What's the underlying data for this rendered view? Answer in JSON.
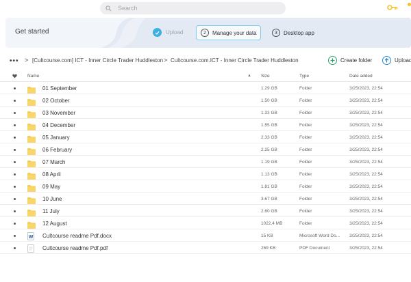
{
  "search": {
    "placeholder": "Search"
  },
  "banner": {
    "title": "Get started",
    "steps": [
      {
        "number": "",
        "label": "Upload",
        "state": "done"
      },
      {
        "number": "2",
        "label": "Manage your data",
        "state": "active"
      },
      {
        "number": "3",
        "label": "Desktop app",
        "state": "todo"
      }
    ]
  },
  "breadcrumb": {
    "more": "•••",
    "items": [
      "[Cultcourse.com] ICT - Inner Circle Trader Huddleston",
      "Cultcourse.com.ICT - Inner Circle Trader Huddleston"
    ],
    "separator": ">"
  },
  "actions": {
    "create_folder": "Create folder",
    "upload": "Upload"
  },
  "table": {
    "headers": {
      "name": "Name",
      "size": "Size",
      "type": "Type",
      "date": "Date added",
      "sort_arrow": "▲"
    },
    "rows": [
      {
        "name": "01 September",
        "size": "1.29 GB",
        "type": "Folder",
        "date": "3/25/2023, 22:54",
        "icon": "folder-icon"
      },
      {
        "name": "02 October",
        "size": "1.50 GB",
        "type": "Folder",
        "date": "3/25/2023, 22:54",
        "icon": "folder-icon"
      },
      {
        "name": "03 November",
        "size": "1.33 GB",
        "type": "Folder",
        "date": "3/25/2023, 22:54",
        "icon": "folder-icon"
      },
      {
        "name": "04 December",
        "size": "1.55 GB",
        "type": "Folder",
        "date": "3/25/2023, 22:54",
        "icon": "folder-icon"
      },
      {
        "name": "05 January",
        "size": "2.33 GB",
        "type": "Folder",
        "date": "3/25/2023, 22:54",
        "icon": "folder-icon"
      },
      {
        "name": "06 February",
        "size": "2.25 GB",
        "type": "Folder",
        "date": "3/25/2023, 22:54",
        "icon": "folder-icon"
      },
      {
        "name": "07 March",
        "size": "1.19 GB",
        "type": "Folder",
        "date": "3/25/2023, 22:54",
        "icon": "folder-icon"
      },
      {
        "name": "08 April",
        "size": "1.13 GB",
        "type": "Folder",
        "date": "3/25/2023, 22:54",
        "icon": "folder-icon"
      },
      {
        "name": "09 May",
        "size": "1.81 GB",
        "type": "Folder",
        "date": "3/25/2023, 22:54",
        "icon": "folder-icon"
      },
      {
        "name": "10 June",
        "size": "3.67 GB",
        "type": "Folder",
        "date": "3/25/2023, 22:54",
        "icon": "folder-icon"
      },
      {
        "name": "11 July",
        "size": "2.60 GB",
        "type": "Folder",
        "date": "3/25/2023, 22:54",
        "icon": "folder-icon"
      },
      {
        "name": "12 August",
        "size": "1022.4 MB",
        "type": "Folder",
        "date": "3/25/2023, 22:54",
        "icon": "folder-icon"
      },
      {
        "name": "Cultcourse readme Pdf.docx",
        "size": "15 KB",
        "type": "Microsoft Word Do...",
        "date": "3/25/2023, 22:54",
        "icon": "word-doc-icon",
        "icon_letter": "W"
      },
      {
        "name": "Cultcourse readme Pdf.pdf",
        "size": "269 KB",
        "type": "PDF Document",
        "date": "3/25/2023, 22:54",
        "icon": "pdf-doc-icon"
      }
    ]
  },
  "colors": {
    "accent": "#3dafe0",
    "folder": "#f7cd55",
    "create_folder": "#2aa36b",
    "upload": "#2d88c9",
    "banner_bg": "#e3eaf3",
    "key": "#f4c12b"
  }
}
